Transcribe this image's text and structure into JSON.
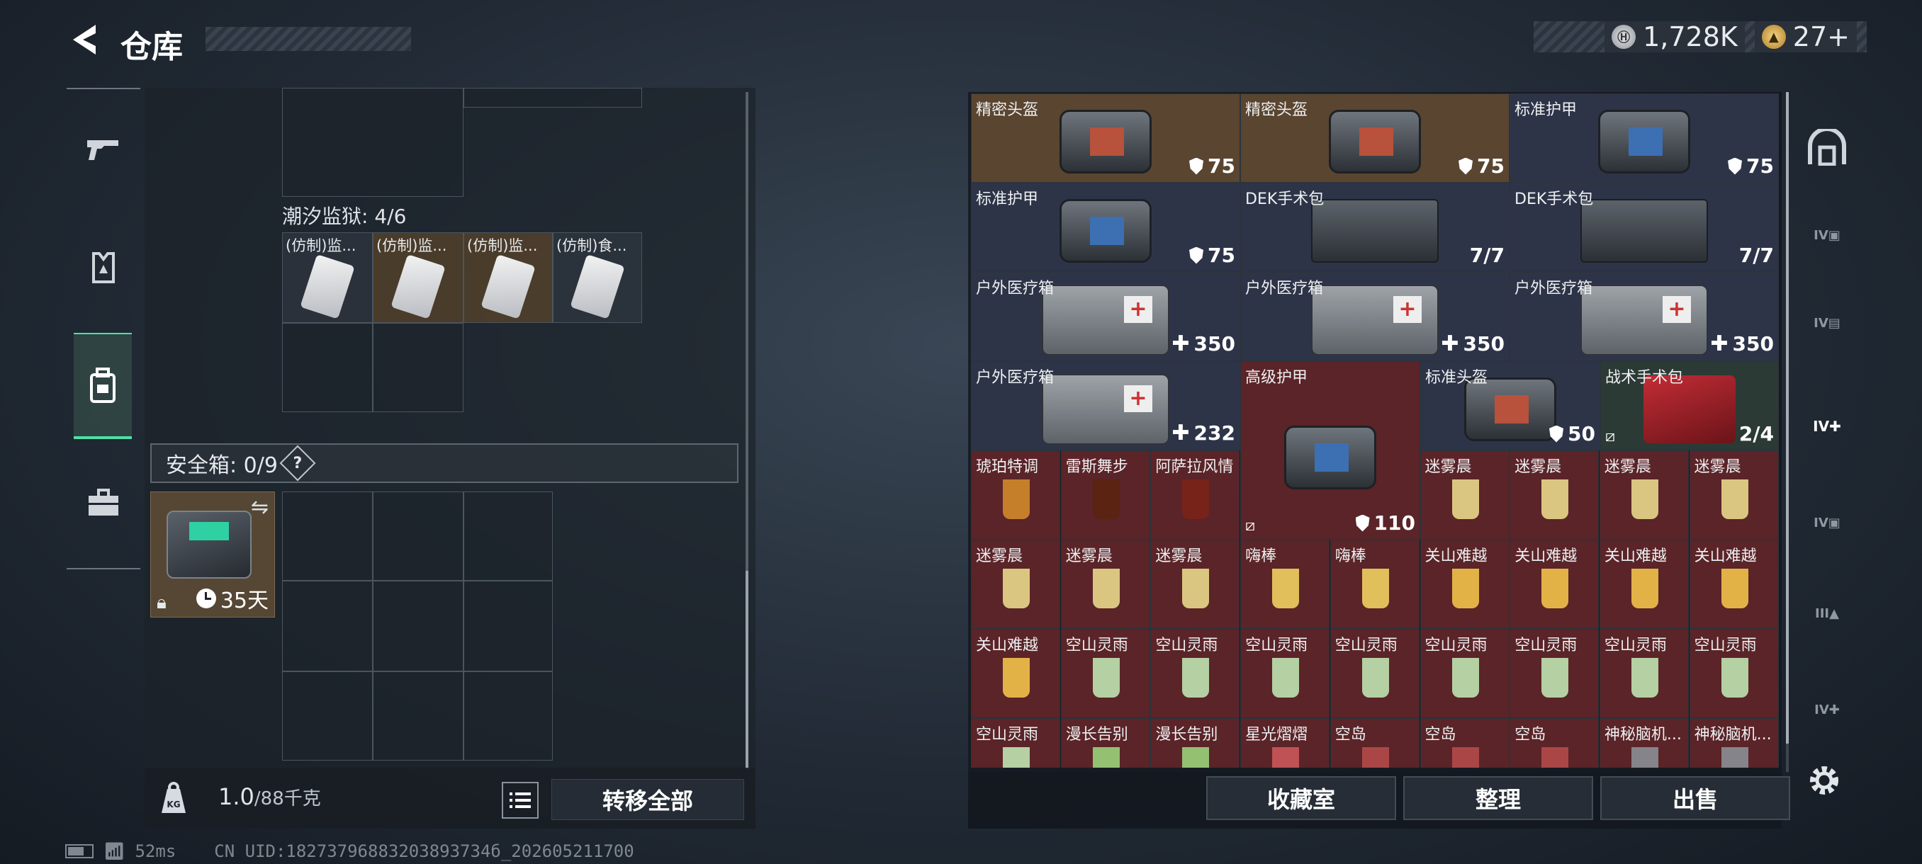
{
  "header": {
    "title": "仓库"
  },
  "currency": {
    "silver": "1,728K",
    "gold": "27+"
  },
  "left": {
    "section_label": "潮汐监狱: 4/6",
    "section_items": [
      {
        "name": "(仿制)监..."
      },
      {
        "name": "(仿制)监..."
      },
      {
        "name": "(仿制)监..."
      },
      {
        "name": "(仿制)食..."
      }
    ],
    "safe_label": "安全箱: 0/9",
    "safe_help": "?",
    "safe_timer": "35天",
    "weight_value": "1.0",
    "weight_max": "/88千克",
    "transfer_all": "转移全部"
  },
  "status": {
    "ping": "52ms",
    "uid": "CN UID:18273796883203893734б_202605211700"
  },
  "stash": {
    "rows": [
      [
        {
          "name": "精密头盔",
          "val": "75",
          "type": "armor",
          "bg": "brown",
          "w": 1,
          "h": 1
        },
        {
          "name": "精密头盔",
          "val": "75",
          "type": "armor",
          "bg": "brown",
          "w": 1,
          "h": 1
        },
        {
          "name": "标准护甲",
          "val": "75",
          "type": "armor",
          "bg": "navy",
          "w": 1,
          "h": 1
        }
      ]
    ],
    "cells": [
      {
        "name": "精密头盔",
        "val": "75",
        "icon": "shield",
        "bg": "brown",
        "art": "bag-red"
      },
      {
        "name": "精密头盔",
        "val": "75",
        "icon": "shield",
        "bg": "brown",
        "art": "bag-red"
      },
      {
        "name": "标准护甲",
        "val": "75",
        "icon": "shield",
        "bg": "navy",
        "art": "bag-blue"
      },
      {
        "name": "标准护甲",
        "val": "75",
        "icon": "shield",
        "bg": "navy",
        "art": "bag-blue"
      },
      {
        "name": "DEK手术包",
        "val": "7/7",
        "icon": "",
        "bg": "navy",
        "art": "kit"
      },
      {
        "name": "DEK手术包",
        "val": "7/7",
        "icon": "",
        "bg": "navy",
        "art": "kit"
      },
      {
        "name": "户外医疗箱",
        "val": "350",
        "icon": "plus",
        "bg": "navy",
        "art": "medbox"
      },
      {
        "name": "户外医疗箱",
        "val": "350",
        "icon": "plus",
        "bg": "navy",
        "art": "medbox"
      },
      {
        "name": "户外医疗箱",
        "val": "350",
        "icon": "plus",
        "bg": "navy",
        "art": "medbox"
      },
      {
        "name": "户外医疗箱",
        "val": "232",
        "icon": "plus",
        "bg": "navy",
        "art": "medbox"
      },
      {
        "name": "高级护甲",
        "val": "110",
        "icon": "shield",
        "bg": "red",
        "art": "bag-blue"
      },
      {
        "name": "标准头盔",
        "val": "50",
        "icon": "shield",
        "bg": "navy",
        "art": "bag-red"
      },
      {
        "name": "战术手术包",
        "val": "2/4",
        "icon": "",
        "bg": "green",
        "art": "redkit"
      }
    ],
    "drinks_row1": [
      "琥珀特调",
      "雷斯舞步",
      "阿萨拉风情",
      "迷雾晨",
      "迷雾晨",
      "迷雾晨",
      "迷雾晨"
    ],
    "drinks_row2": [
      "迷雾晨",
      "迷雾晨",
      "迷雾晨",
      "嗨棒",
      "嗨棒",
      "关山难越",
      "关山难越",
      "关山难越",
      "关山难越"
    ],
    "drinks_row3": [
      "关山难越",
      "空山灵雨",
      "空山灵雨",
      "空山灵雨",
      "空山灵雨",
      "空山灵雨",
      "空山灵雨",
      "空山灵雨",
      "空山灵雨"
    ],
    "drinks_row4": [
      "空山灵雨",
      "漫长告别",
      "漫长告别",
      "星光熠熠",
      "空岛",
      "空岛",
      "空岛",
      "神秘脑机...",
      "神秘脑机..."
    ]
  },
  "buttons": {
    "collection": "收藏室",
    "sort": "整理",
    "sell": "出售"
  }
}
